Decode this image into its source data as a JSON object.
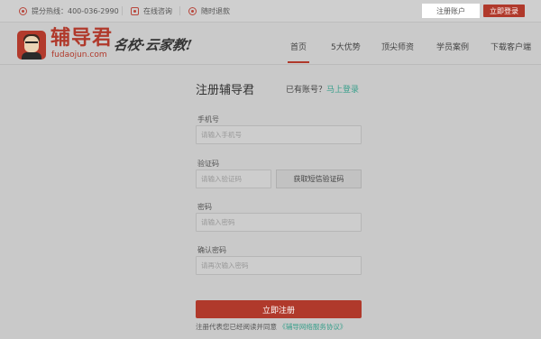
{
  "topbar": {
    "hotline_label": "提分热线：400-036-2990",
    "consult_label": "在线咨询",
    "refund_label": "随时退款",
    "register_button": "注册账户",
    "login_button": "立即登录"
  },
  "brand": {
    "name": "辅导君",
    "domain": "fudaojun.com",
    "slogan": "名校·云家教!",
    "accent_color": "#b0392b"
  },
  "nav": {
    "items": [
      "首页",
      "5大优势",
      "顶尖师资",
      "学员案例",
      "下载客户端"
    ],
    "active": "首页"
  },
  "form": {
    "title": "注册辅导君",
    "has_account": "已有账号？",
    "login_link": "马上登录",
    "phone": {
      "label": "手机号",
      "placeholder": "请输入手机号"
    },
    "code": {
      "label": "验证码",
      "placeholder": "请输入验证码",
      "button": "获取短信验证码"
    },
    "password": {
      "label": "密码",
      "placeholder": "请输入密码"
    },
    "confirm": {
      "label": "确认密码",
      "placeholder": "请再次输入密码"
    },
    "submit": "立即注册",
    "agreement_text": "注册代表您已经阅读并同意",
    "agreement_link": "《辅导网络服务协议》"
  }
}
